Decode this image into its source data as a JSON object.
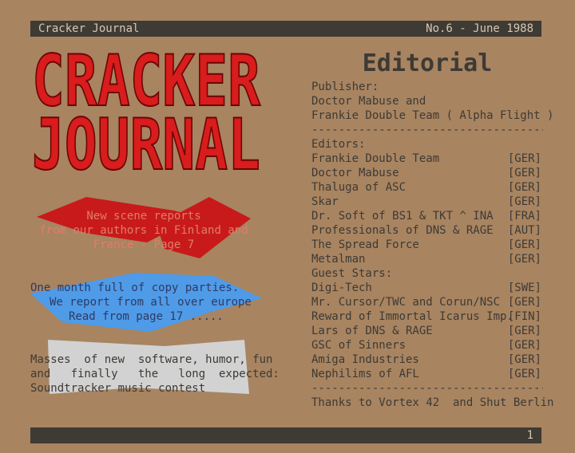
{
  "header": {
    "left": "Cracker Journal",
    "right": "No.6 - June 1988"
  },
  "logo": {
    "line1": "CRACKER",
    "line2": "JOURNAL",
    "color": "#d91c1c"
  },
  "promos": {
    "scene": [
      "New scene reports",
      "from our authors in Finland and",
      "France - Page 7"
    ],
    "parties": [
      "One month full of copy parties.",
      "We report from all over europe",
      "Read from page 17 ....."
    ],
    "software": [
      "Masses  of new  software, humor, fun",
      "and   finally   the   long  expected:",
      "Soundtracker music contest"
    ]
  },
  "colors": {
    "red_shape": "#c81a1a",
    "blue_shape": "#4f9be8",
    "grey_shape": "#d2d2d2"
  },
  "editorial": {
    "title": "Editorial",
    "publisher_label": "Publisher:",
    "publisher_lines": [
      "Doctor Mabuse and",
      "Frankie Double Team ( Alpha Flight )"
    ],
    "separator": "-------------------------------------------",
    "editors_label": "Editors:",
    "editors": [
      {
        "name": "Frankie Double Team",
        "tag": "[GER]"
      },
      {
        "name": "Doctor Mabuse",
        "tag": "[GER]"
      },
      {
        "name": "Thaluga of ASC",
        "tag": "[GER]"
      },
      {
        "name": "Skar",
        "tag": "[GER]"
      },
      {
        "name": "Dr. Soft of BS1 & TKT ^ INA",
        "tag": "[FRA]"
      },
      {
        "name": "Professionals of DNS & RAGE",
        "tag": "[AUT]"
      },
      {
        "name": "The Spread Force",
        "tag": "[GER]"
      },
      {
        "name": "Metalman",
        "tag": "[GER]"
      }
    ],
    "guests_label": "Guest Stars:",
    "guests": [
      {
        "name": "Digi-Tech",
        "tag": "[SWE]"
      },
      {
        "name": "Mr. Cursor/TWC and Corun/NSC",
        "tag": "[GER]"
      },
      {
        "name": "Reward of Immortal Icarus Imp.",
        "tag": "[FIN]"
      },
      {
        "name": "Lars of DNS & RAGE",
        "tag": "[GER]"
      },
      {
        "name": "GSC of Sinners",
        "tag": "[GER]"
      },
      {
        "name": "Amiga Industries",
        "tag": "[GER]"
      },
      {
        "name": "Nephilims of AFL",
        "tag": "[GER]"
      }
    ],
    "thanks": "Thanks to Vortex 42  and Shut Berlin"
  },
  "footer": {
    "page": "1"
  }
}
